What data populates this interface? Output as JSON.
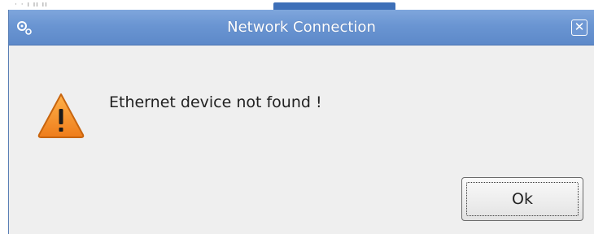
{
  "dialog": {
    "title": "Network Connection",
    "message": "Ethernet device not found !",
    "ok_label": "Ok",
    "close_symbol": "✕"
  },
  "icons": {
    "title": "gears-icon",
    "warning": "warning-icon",
    "close": "close-icon"
  },
  "colors": {
    "titlebar": "#6a95d2",
    "warning_fill": "#f3952a",
    "dialog_bg": "#efefef"
  }
}
